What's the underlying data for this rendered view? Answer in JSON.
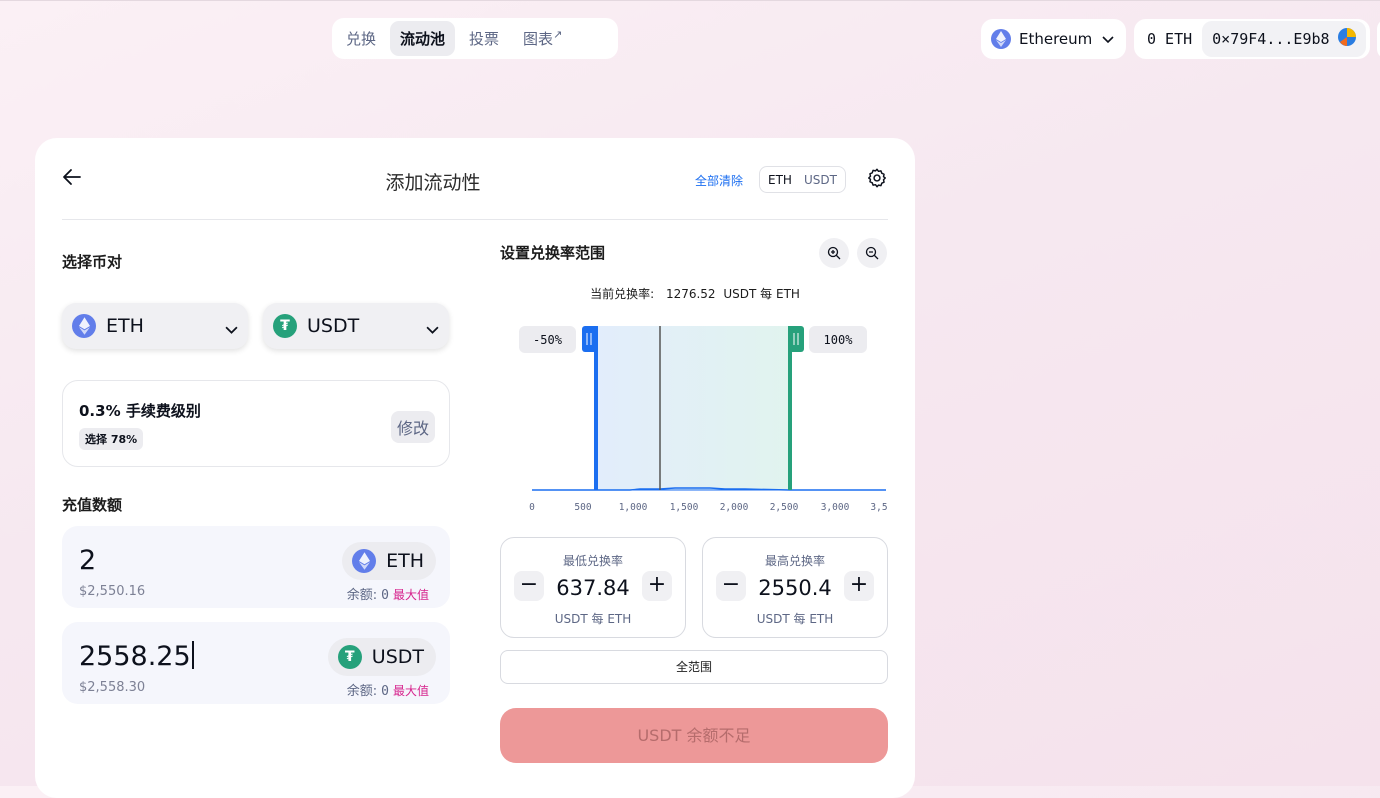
{
  "nav": {
    "items": [
      {
        "label": "兑换"
      },
      {
        "label": "流动池"
      },
      {
        "label": "投票"
      },
      {
        "label": "图表",
        "suffix": "↗"
      }
    ],
    "active": "流动池"
  },
  "network": {
    "name": "Ethereum"
  },
  "wallet": {
    "balance": "0 ETH",
    "address": "0×79F4...E9b8"
  },
  "panel": {
    "title": "添加流动性",
    "clear_all": "全部清除",
    "toggle": [
      "ETH",
      "USDT"
    ],
    "toggle_selected": "ETH"
  },
  "pair": {
    "label": "选择币对",
    "token_a": "ETH",
    "token_b": "USDT",
    "usdt_symbol": "₮"
  },
  "fee": {
    "title": "0.3% 手续费级别",
    "badge": "选择 78%",
    "edit": "修改"
  },
  "deposit": {
    "label": "充值数额",
    "eth": {
      "amount": "2",
      "usd": "$2,550.16",
      "token": "ETH",
      "balance_label": "余额:",
      "balance": "0",
      "max": "最大值"
    },
    "usdt": {
      "amount": "2558.25",
      "usd": "$2,558.30",
      "token": "USDT",
      "balance_label": "余额:",
      "balance": "0",
      "max": "最大值"
    }
  },
  "range": {
    "title": "设置兑换率范围",
    "current_rate_label": "当前兑换率:",
    "current_rate": "1276.52",
    "current_rate_unit": "USDT 每 ETH",
    "min": {
      "label": "最低兑换率",
      "value": "637.84",
      "unit": "USDT 每 ETH",
      "minus": "−",
      "plus": "+"
    },
    "max": {
      "label": "最高兑换率",
      "value": "2550.4",
      "unit": "USDT 每 ETH",
      "minus": "−",
      "plus": "+"
    },
    "full_range": "全范围",
    "chart": {
      "min_pct": "-50%",
      "max_pct": "100%",
      "ticks": [
        "0",
        "500",
        "1,000",
        "1,500",
        "2,000",
        "2,500",
        "3,000",
        "3,5"
      ]
    }
  },
  "submit": {
    "label": "USDT 余额不足"
  },
  "colors": {
    "accent_blue": "#1b6ef0",
    "accent_green": "#26a17b",
    "eth": "#627eea",
    "usdt": "#26a17b",
    "submit_bg": "#ed9898",
    "max_pink": "#d6238c"
  }
}
